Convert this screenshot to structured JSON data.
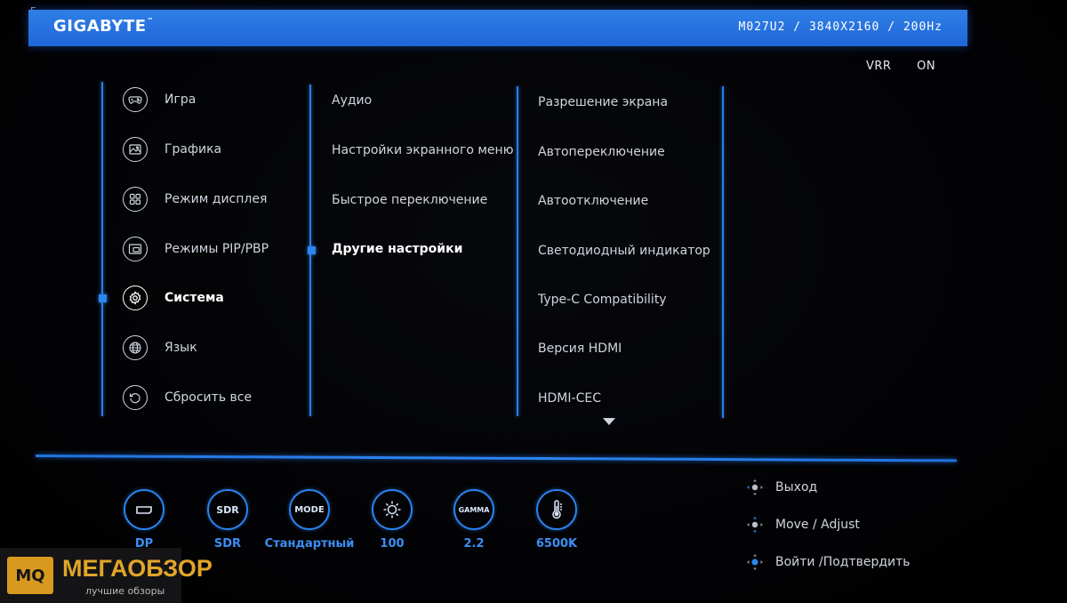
{
  "corner_letter": "F",
  "header": {
    "brand": "GIGABYTE",
    "brand_tm": "™",
    "model_info": "M027U2 / 3840X2160 / 200Hz"
  },
  "vrr": {
    "label": "VRR",
    "value": "ON"
  },
  "main_menu": {
    "items": [
      {
        "label": "Игра",
        "icon": "gamepad-icon"
      },
      {
        "label": "Графика",
        "icon": "image-icon"
      },
      {
        "label": "Режим дисплея",
        "icon": "grid-icon"
      },
      {
        "label": "Режимы PIP/PBP",
        "icon": "pip-icon"
      },
      {
        "label": "Система",
        "icon": "gear-icon",
        "selected": true
      },
      {
        "label": "Язык",
        "icon": "globe-icon"
      },
      {
        "label": "Сбросить все",
        "icon": "reset-icon"
      }
    ]
  },
  "sub_menu": {
    "items": [
      {
        "label": "Аудио"
      },
      {
        "label": "Настройки экранного меню"
      },
      {
        "label": "Быстрое переключение"
      },
      {
        "label": "Другие настройки",
        "selected": true
      }
    ]
  },
  "options_menu": {
    "items": [
      {
        "label": "Разрешение экрана"
      },
      {
        "label": "Автопереключение"
      },
      {
        "label": "Автоотключение"
      },
      {
        "label": "Светодиодный индикатор"
      },
      {
        "label": "Type-C Compatibility"
      },
      {
        "label": "Версия HDMI"
      },
      {
        "label": "HDMI-CEC"
      }
    ]
  },
  "status_bar": [
    {
      "icon": "displayport-icon",
      "icon_text": "",
      "value": "DP"
    },
    {
      "icon": "sdr-icon",
      "icon_text": "SDR",
      "value": "SDR"
    },
    {
      "icon": "mode-icon",
      "icon_text": "MODE",
      "value": "Стандартный"
    },
    {
      "icon": "brightness-icon",
      "icon_text": "",
      "value": "100"
    },
    {
      "icon": "gamma-icon",
      "icon_text": "GAMMA",
      "value": "2.2"
    },
    {
      "icon": "thermometer-icon",
      "icon_text": "",
      "value": "6500K"
    }
  ],
  "hints": [
    {
      "icon": "joystick-left-icon",
      "label": "Выход"
    },
    {
      "icon": "joystick-updown-icon",
      "label": "Move / Adjust"
    },
    {
      "icon": "joystick-press-icon",
      "label": "Войти /Подтвердить"
    }
  ],
  "watermark": {
    "logo": "MQ",
    "title": "МЕГАОБЗОР",
    "subtitle": "лучшие обзоры"
  },
  "colors": {
    "accent": "#2a82ee",
    "header": "#2272e0",
    "background": "#020204",
    "watermark_gold": "#e1a529"
  }
}
